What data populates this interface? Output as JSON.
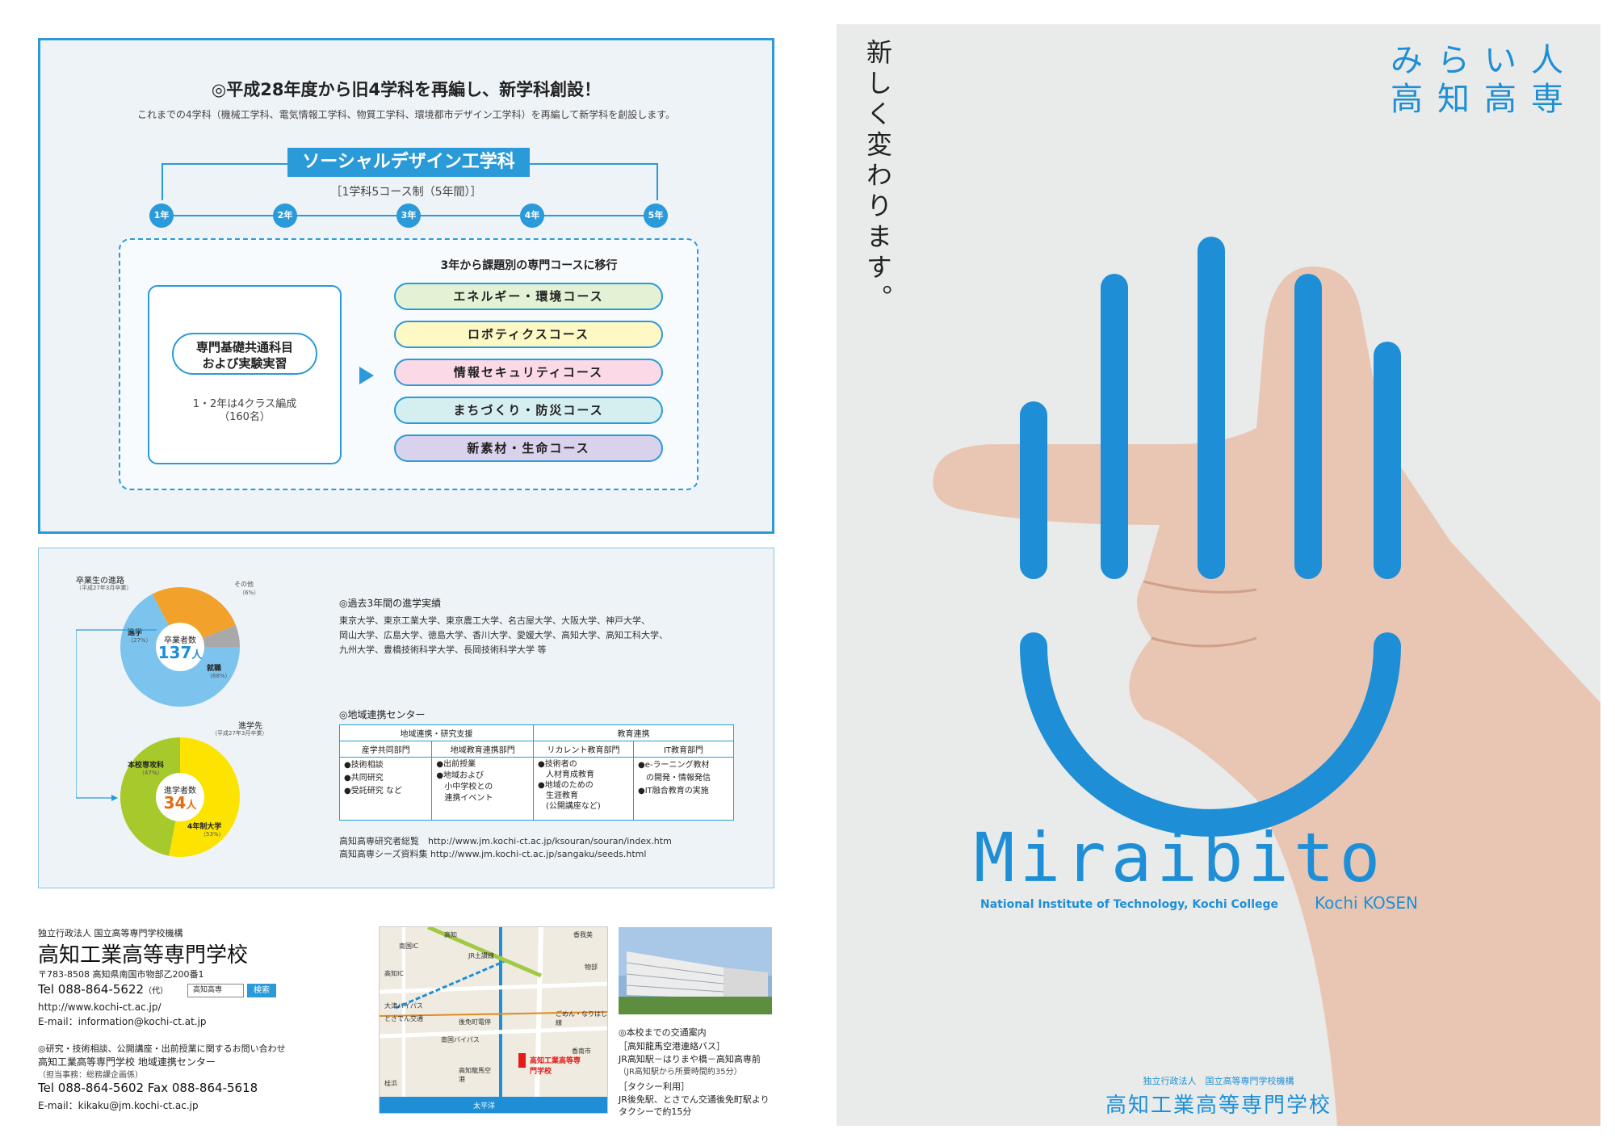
{
  "top": {
    "title": "◎平成28年度から旧4学科を再編し、新学科創設！",
    "subtitle": "これまでの4学科（機械工学科、電気情報工学科、物質工学科、環境都市デザイン工学科）を再編して新学科を創設します。",
    "dept": "ソーシャルデザイン工学科",
    "dept_sub": "［1学科5コース制（5年間）］",
    "years": [
      "1年",
      "2年",
      "3年",
      "4年",
      "5年"
    ],
    "basic_line1": "専門基礎共通科目",
    "basic_line2": "および実験実習",
    "basic_note1": "1・2年は4クラス編成",
    "basic_note2": "（160名）",
    "courses_head": "3年から課題別の専門コースに移行",
    "courses": [
      {
        "label": "エネルギー・環境コース",
        "color": "#e3f2d4"
      },
      {
        "label": "ロボティクスコース",
        "color": "#fdf8c4"
      },
      {
        "label": "情報セキュリティコース",
        "color": "#fbd9e6"
      },
      {
        "label": "まちづくり・防災コース",
        "color": "#d5eef0"
      },
      {
        "label": "新素材・生命コース",
        "color": "#d9d2ec"
      }
    ]
  },
  "graduates": {
    "title": "卒業生の進路",
    "title_note": "（平成27年3月卒業）",
    "center_label": "卒業者数",
    "center_value": "137",
    "center_unit": "人",
    "slices": [
      {
        "label": "就職",
        "pct": "（68%）",
        "value": 68,
        "color": "#7cc3ee"
      },
      {
        "label": "進学",
        "pct": "（27%）",
        "value": 27,
        "color": "#f2a22a"
      },
      {
        "label": "その他",
        "pct": "（6%）",
        "value": 6,
        "color": "#a9a9a9"
      }
    ]
  },
  "advance": {
    "title": "進学先",
    "title_note": "（平成27年3月卒業）",
    "center_label": "進学者数",
    "center_value": "34",
    "center_unit": "人",
    "slices": [
      {
        "label": "4年制大学",
        "pct": "（53%）",
        "value": 53,
        "color": "#fde400"
      },
      {
        "label": "本校専攻科",
        "pct": "（47%）",
        "value": 47,
        "color": "#a6c92c"
      }
    ]
  },
  "results": {
    "title": "◎過去3年間の進学実績",
    "line1": "東京大学、東京工業大学、東京農工大学、名古屋大学、大阪大学、神戸大学、",
    "line2": "岡山大学、広島大学、徳島大学、香川大学、愛媛大学、高知大学、高知工科大学、",
    "line3": "九州大学、豊橋技術科学大学、長岡技術科学大学 等"
  },
  "region": {
    "title": "◎地域連携センター",
    "head1": "地域連携・研究支援",
    "head2": "教育連携",
    "cols": [
      "産学共同部門",
      "地域教育連携部門",
      "リカレント教育部門",
      "IT教育部門"
    ],
    "col1": [
      "●技術相談",
      "●共同研究",
      "●受託研究 など"
    ],
    "col2": [
      "●出前授業",
      "●地域および",
      "　小中学校との",
      "　連携イベント"
    ],
    "col3": [
      "●技術者の",
      "　人材育成教育",
      "●地域のための",
      "　生涯教育",
      "　(公開講座など)"
    ],
    "col4": [
      "●e-ラーニング教材",
      "　の開発・情報発信",
      "●IT融合教育の実施"
    ],
    "link1": "高知高専研究者総覧　http://www.jm.kochi-ct.ac.jp/ksouran/souran/index.htm",
    "link2": "高知高専シーズ資料集 http://www.jm.kochi-ct.ac.jp/sangaku/seeds.html"
  },
  "contact": {
    "org": "独立行政法人 国立高等専門学校機構",
    "school": "高知工業高等専門学校",
    "address": "〒783-8508 高知県南国市物部乙200番1",
    "tel": "Tel 088-864-5622",
    "tel_note": "（代）",
    "search_box": "高知高専",
    "search_button": "検索",
    "url": "http://www.kochi-ct.ac.jp/",
    "email": "E-mail：information@kochi-ct.at.jp",
    "inquiry": "◎研究・技術相談、公開講座・出前授業に関するお問い合わせ",
    "center": "高知工業高等専門学校 地域連携センター",
    "center_note": "（担当事務：総務課企画係）",
    "tel2": "Tel 088-864-5602  Fax 088-864-5618",
    "email2": "E-mail：kikaku@jm.kochi-ct.ac.jp"
  },
  "map": {
    "labels": [
      "高知",
      "南国IC",
      "JR土讃線",
      "高知IC",
      "大津バイパス",
      "ごめん・なりはし線",
      "とさでん交通",
      "後免町電停",
      "南国バイパス",
      "香南市",
      "高知龍馬空港",
      "太平洋",
      "香我美",
      "物部",
      "桂浜",
      "高知工業高等専門学校"
    ]
  },
  "access": {
    "title": "◎本校までの交通案内",
    "bus": "［高知龍馬空港連絡バス］",
    "bus_detail1": "JR高知駅－はりまや橋－高知高専前",
    "bus_detail2": "（JR高知駅から所要時間約35分）",
    "taxi": "［タクシー利用］",
    "taxi_detail1": "JR後免駅、とさでん交通後免町駅より",
    "taxi_detail2": "タクシーで約15分"
  },
  "cover": {
    "vertical": "新しく変わります。",
    "title1": "みらい人",
    "title2": "高知高専",
    "logo": "Miraibito",
    "logo_sub": "National Institute of Technology, Kochi College",
    "logo_sub2": "Kochi KOSEN",
    "org": "独立行政法人　国立高等専門学校機構",
    "school": "高知工業高等専門学校"
  }
}
